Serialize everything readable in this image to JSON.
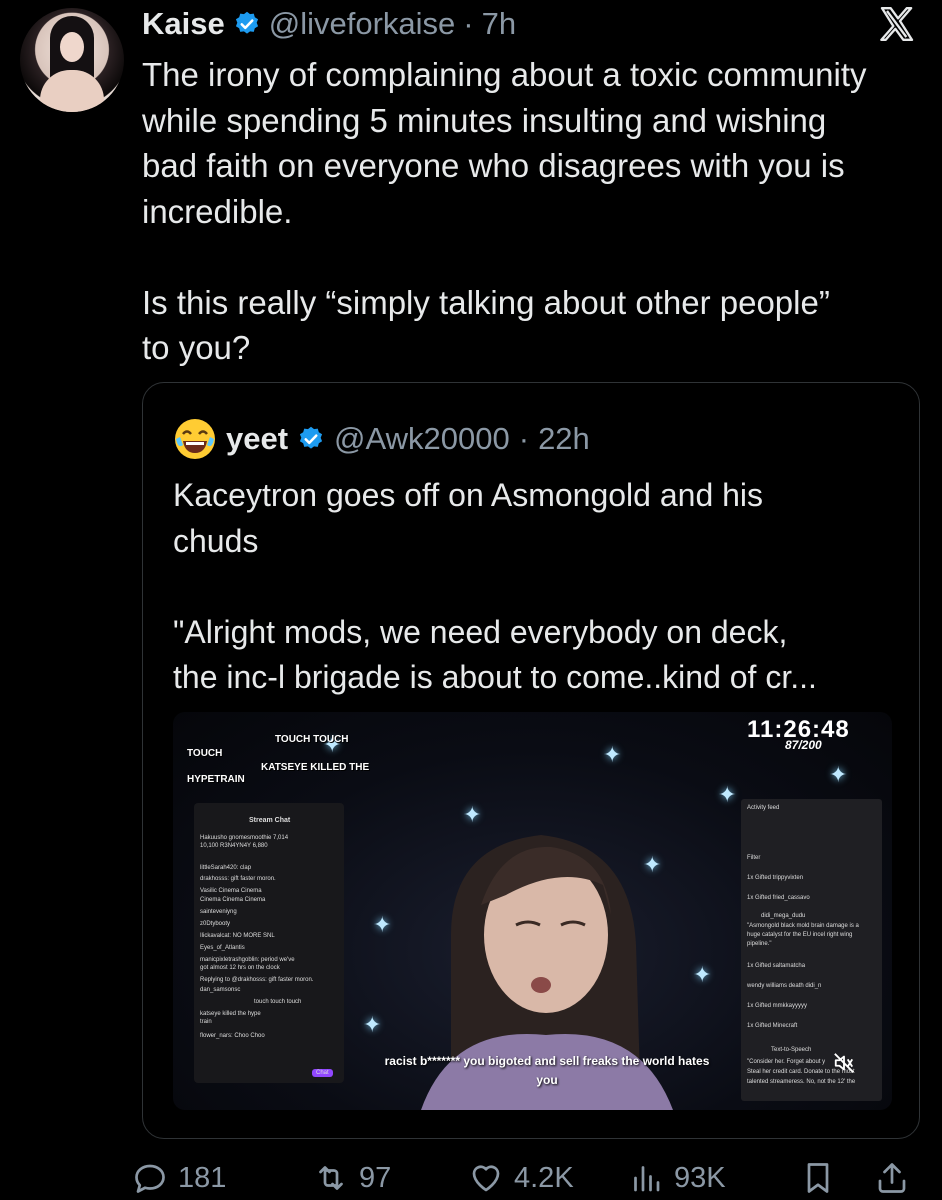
{
  "tweet": {
    "display_name": "Kaise",
    "handle": "@liveforkaise",
    "separator": "·",
    "time": "7h",
    "text": "The irony of complaining about a toxic community\nwhile spending 5 minutes insulting and wishing\nbad faith on everyone who disagrees with you is\nincredible.\n\nIs this really “simply talking about other people”\nto you?"
  },
  "quote": {
    "display_name": "yeet",
    "handle": "@Awk20000",
    "separator": "·",
    "time": "22h",
    "text": "Kaceytron goes off on Asmongold and his\nchuds\n\n\"Alright mods, we need everybody on deck,\nthe inc-l brigade is about to come..kind of cr..."
  },
  "stream": {
    "clock": "11:26:48",
    "goal": "87/200",
    "top_left_line1": "TOUCH TOUCH",
    "top_left_line2": "TOUCH",
    "top_left_line3": "KATSEYE KILLED THE",
    "top_left_line4": "HYPETRAIN",
    "chat_title": "Stream Chat",
    "chat_lines": [
      "Hakuusho  gnomesmoothie 7,014",
      "10,100    R3N4YN4Y  6,880",
      "littleSarah420: clap",
      "drakhosss: gift faster moron.",
      "Vasilic  Cinema  Cinema",
      "Cinema  Cinema  Cinema",
      "sainteveniyng",
      "z0Dtybooty",
      "Ilickavalcat: NO MORE SNL",
      "Eyes_of_Atlantis",
      "manicpixletrashgoblin: period we've",
      "got almost 12 hrs on the clock",
      "Replying to @drakhosss: gift faster moron.",
      "dan_samsonsc",
      "touch touch touch",
      "katseye killed the hype",
      "train",
      "flower_nars: Choo Choo"
    ],
    "chat_button": "Chat",
    "activity_title": "Activity feed",
    "activity_filter": "Filter",
    "activity_lines": [
      "1x Gifted  trippyvixten",
      "1x Gifted  fried_cassavo",
      "didi_mega_dudu",
      "\"Asmongold black mold brain damage is a",
      "huge catalyst for the EU incel right wing",
      "pipeline.\"",
      "1x Gifted  saltamatcha",
      "wendy williams death  didi_n",
      "1x Gifted  mmkkayyyyy",
      "1x Gifted  Minecraft",
      "Text-to-Speech",
      "\"Consider her. Forget about y",
      "Steal her credit card. Donate to the most",
      "talented streameress. No, not the 12' the"
    ],
    "caption_line1": "racist b******* you bigoted and sell freaks the world hates",
    "caption_line2": "you"
  },
  "actions": {
    "replies": "181",
    "reposts": "97",
    "likes": "4.2K",
    "views": "93K"
  },
  "colors": {
    "background": "#000000",
    "text": "#e7e9ea",
    "muted": "#8b98a5",
    "verified": "#1d9bf0",
    "border": "#2f3336"
  }
}
